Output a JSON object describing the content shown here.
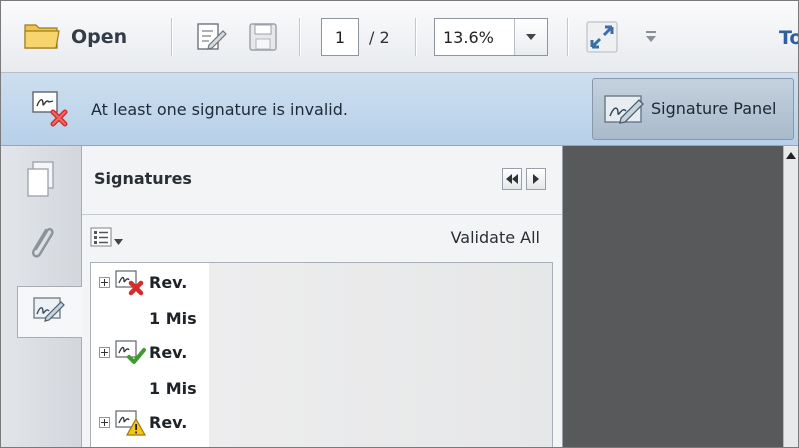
{
  "toolbar": {
    "open_label": "Open",
    "page_current": "1",
    "page_total": "/ 2",
    "zoom_value": "13.6%",
    "cut_off_label": "To",
    "icons": [
      "folder-icon",
      "edit-document-icon",
      "save-icon",
      "zoom-dropdown-icon",
      "fullscreen-icon",
      "customize-toolbar-icon"
    ]
  },
  "message_bar": {
    "text": "At least one signature is invalid.",
    "button_label": "Signature Panel",
    "icon": "invalid-signature-icon"
  },
  "rail": {
    "icons": [
      "pages-icon",
      "attachments-icon",
      "signatures-icon"
    ],
    "active": "signatures-icon"
  },
  "panel": {
    "title": "Signatures",
    "validate_all": "Validate All",
    "signatures": [
      {
        "label": "Rev.",
        "status": "invalid",
        "detail": "1 Mis"
      },
      {
        "label": "Rev.",
        "status": "valid",
        "detail": "1 Mis"
      },
      {
        "label": "Rev.",
        "status": "warning",
        "detail": ""
      }
    ]
  },
  "colors": {
    "message_bar": "#c4d9ee",
    "document_background": "#58595b",
    "accent_text": "#2f5f9e"
  }
}
